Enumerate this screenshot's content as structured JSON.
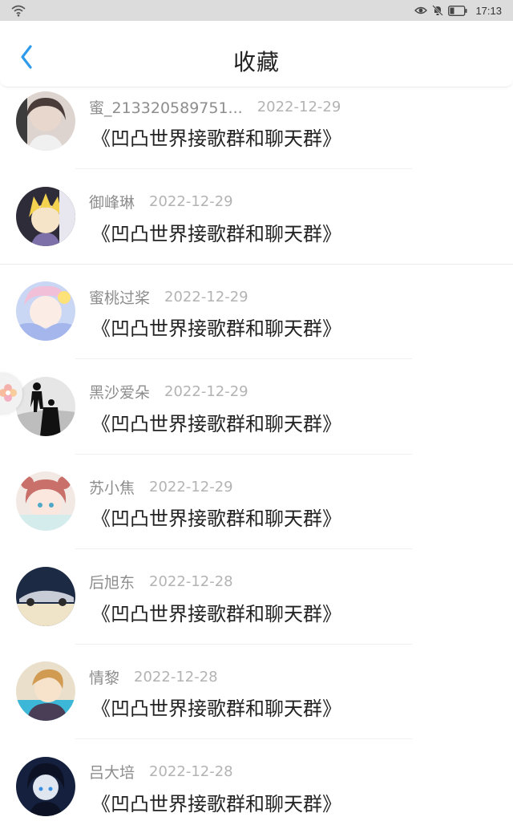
{
  "status_bar": {
    "time": "17:13",
    "icons": [
      "wifi-icon",
      "eye-icon",
      "mute-bell-icon",
      "battery-icon"
    ]
  },
  "header": {
    "title": "收藏",
    "back_icon": "chevron-left-icon",
    "accent_color": "#2f9bea"
  },
  "favorites": [
    {
      "user": "蜜_213320589751...",
      "date": "2022-12-29",
      "title": "《凹凸世界接歌群和聊天群》",
      "avatar_color": "#c9b9b3"
    },
    {
      "user": "御峰琳",
      "date": "2022-12-29",
      "title": "《凹凸世界接歌群和聊天群》",
      "avatar_color": "#e8d36a"
    },
    {
      "user": "蜜桃过桨",
      "date": "2022-12-29",
      "title": "《凹凸世界接歌群和聊天群》",
      "avatar_color": "#b7c8f0"
    },
    {
      "user": "黑沙爱朵",
      "date": "2022-12-29",
      "title": "《凹凸世界接歌群和聊天群》",
      "avatar_color": "#9a9a9a"
    },
    {
      "user": "苏小焦",
      "date": "2022-12-29",
      "title": "《凹凸世界接歌群和聊天群》",
      "avatar_color": "#d99a92"
    },
    {
      "user": "后旭东",
      "date": "2022-12-28",
      "title": "《凹凸世界接歌群和聊天群》",
      "avatar_color": "#24344f"
    },
    {
      "user": "情黎",
      "date": "2022-12-28",
      "title": "《凹凸世界接歌群和聊天群》",
      "avatar_color": "#e3b26d"
    },
    {
      "user": "吕大培",
      "date": "2022-12-28",
      "title": "《凹凸世界接歌群和聊天群》",
      "avatar_color": "#1d2e52"
    }
  ]
}
